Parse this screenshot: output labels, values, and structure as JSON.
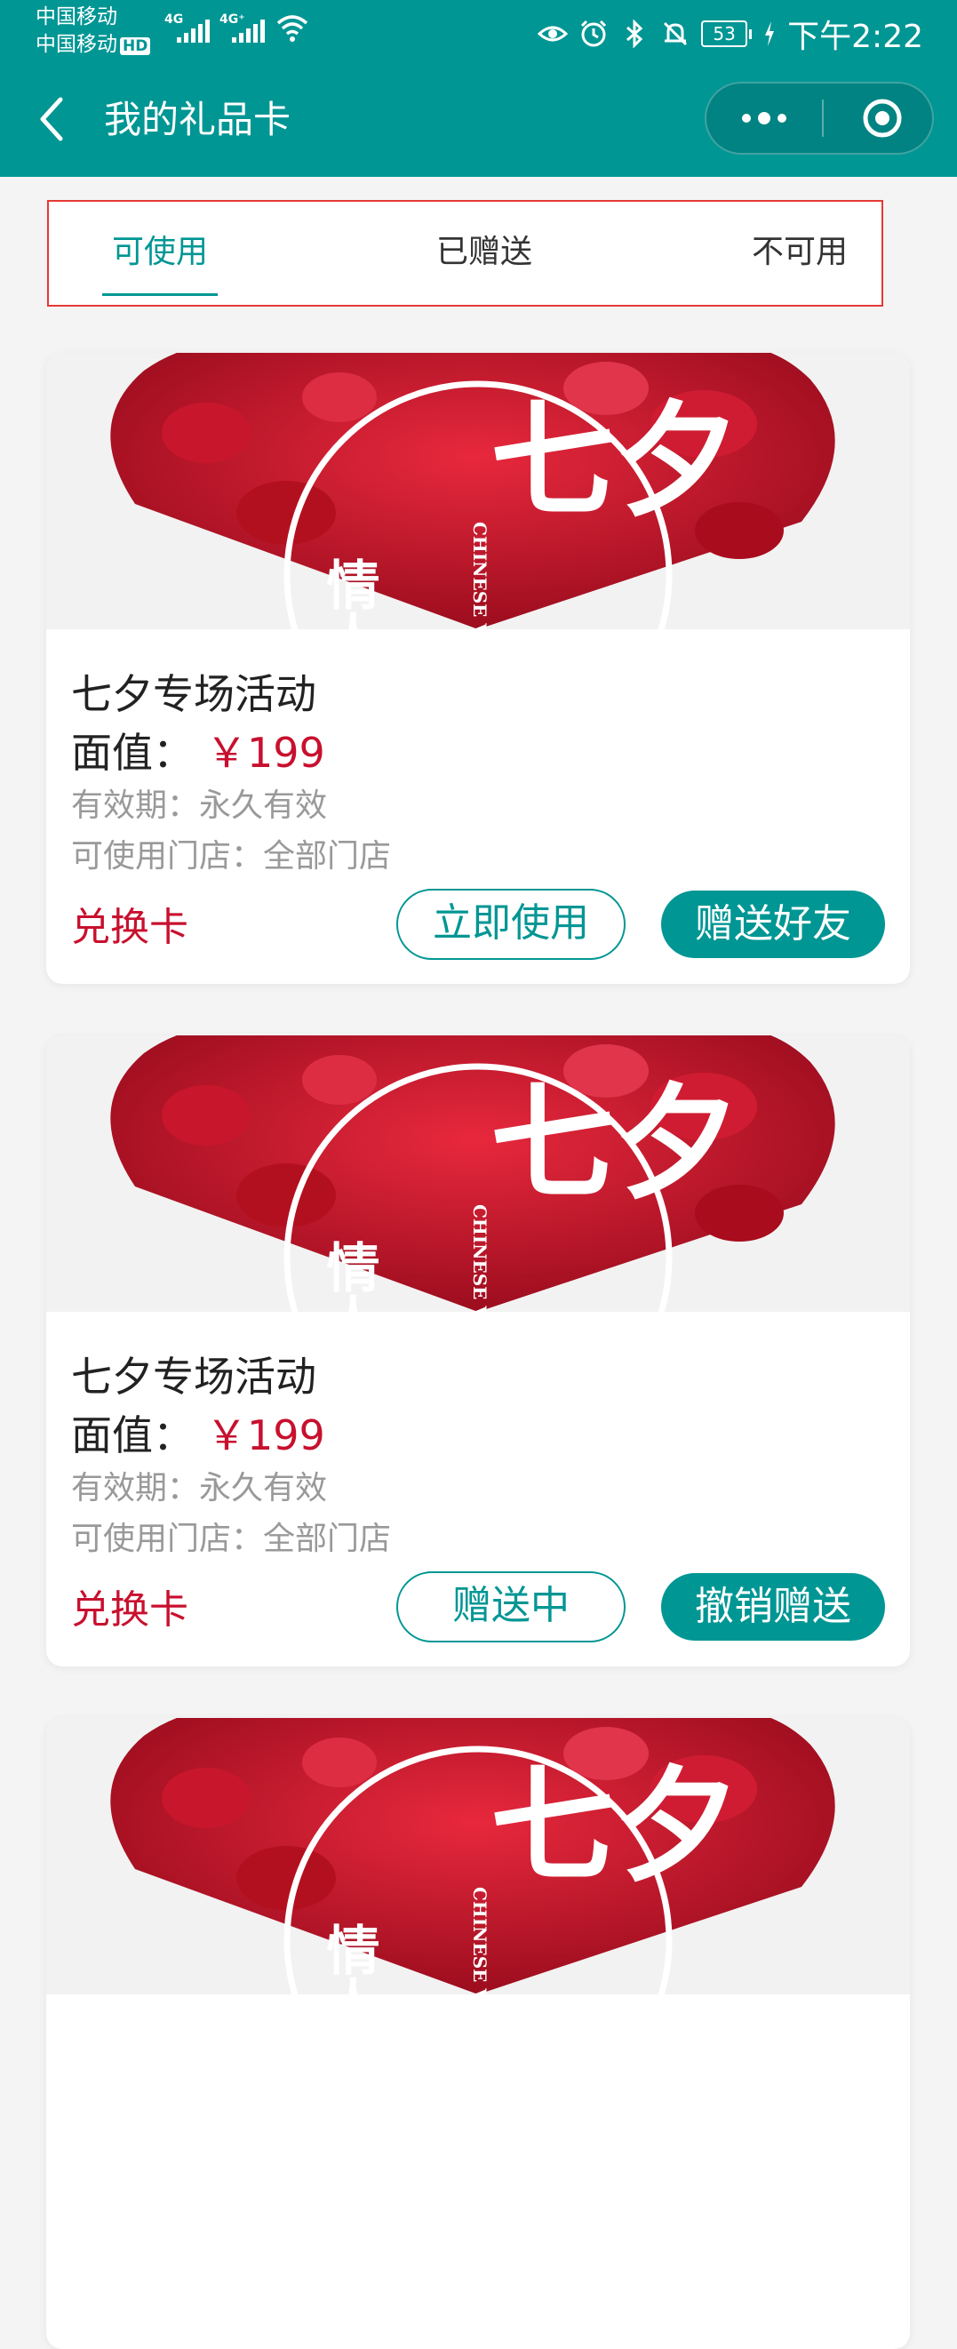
{
  "status_bar": {
    "carrier_1": "中国移动",
    "carrier_2": "中国移动",
    "hd_badge": "HD",
    "sim1_network": "4G",
    "sim2_network": "4G⁺",
    "battery_level": "53",
    "time": "下午2:22",
    "icons": [
      "eye-comfort-icon",
      "alarm-icon",
      "bluetooth-icon",
      "mute-icon",
      "battery-icon",
      "charging-icon"
    ]
  },
  "nav": {
    "title": "我的礼品卡",
    "back_icon": "chevron-left-icon",
    "more_icon": "more-dots-icon",
    "close_icon": "target-circle-icon"
  },
  "tabs": [
    {
      "label": "可使用",
      "active": true
    },
    {
      "label": "已赠送",
      "active": false
    },
    {
      "label": "不可用",
      "active": false
    }
  ],
  "cards": [
    {
      "banner": {
        "big_text": "七夕",
        "small_text": "情人",
        "en_text": "CHINESE VAIENTE"
      },
      "title": "七夕专场活动",
      "face_label": "面值：",
      "price": "￥199",
      "validity": "有效期：永久有效",
      "stores": "可使用门店：全部门店",
      "type": "兑换卡",
      "primary_action": "立即使用",
      "secondary_action": "赠送好友"
    },
    {
      "banner": {
        "big_text": "七夕",
        "small_text": "情人",
        "en_text": "CHINESE VAIENTE"
      },
      "title": "七夕专场活动",
      "face_label": "面值：",
      "price": "￥199",
      "validity": "有效期：永久有效",
      "stores": "可使用门店：全部门店",
      "type": "兑换卡",
      "primary_action": "赠送中",
      "secondary_action": "撤销赠送"
    },
    {
      "banner": {
        "big_text": "七夕",
        "small_text": "情人",
        "en_text": "CHINESE VAIENTE"
      }
    }
  ],
  "colors": {
    "brand_teal": "#009694",
    "price_red": "#c8102e",
    "highlight_border": "#e53935"
  }
}
